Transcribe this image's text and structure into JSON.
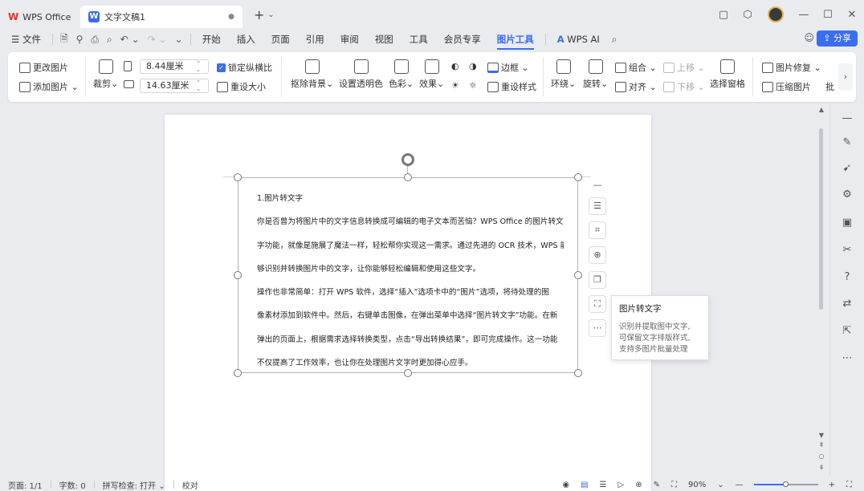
{
  "titlebar": {
    "home_tab": "WPS Office",
    "doc_tab": "文字文稿1",
    "doc_dot": "●",
    "new_tab_icon": "plus-icon"
  },
  "menubar": {
    "file": "文件",
    "items": [
      "开始",
      "插入",
      "页面",
      "引用",
      "审阅",
      "视图",
      "工具",
      "会员专享",
      "图片工具"
    ],
    "active": "图片工具",
    "wps_ai": "WPS AI",
    "share": "分享"
  },
  "ribbon": {
    "change_image": "更改图片",
    "add_image": "添加图片",
    "crop": "裁剪",
    "width_value": "8.44厘米",
    "height_value": "14.63厘米",
    "lock_ratio": "锁定纵横比",
    "reset_size": "重设大小",
    "remove_bg": "抠除背景",
    "set_transparent": "设置透明色",
    "color": "色彩",
    "effects": "效果",
    "border": "边框",
    "reset_style": "重设样式",
    "wrap": "环绕",
    "rotate": "旋转",
    "group": "组合",
    "align": "对齐",
    "move_up": "上移",
    "move_down": "下移",
    "selection_pane": "选择窗格",
    "image_repair": "图片修复",
    "compress": "压缩图片",
    "batch": "批"
  },
  "document": {
    "lines": [
      "1.图片转文字",
      "你是否曾为将图片中的文字信息转换成可编辑的电子文本而苦恼？WPS Office 的图片转文",
      "字功能，就像是施展了魔法一样，轻松帮你实现这一需求。通过先进的 OCR 技术，WPS 能",
      "够识别并转换图片中的文字，让你能够轻松编辑和使用这些文字。",
      "操作也非常简单：打开 WPS 软件，选择“插入”选项卡中的“图片”选项，将待处理的图",
      "像素材添加到软件中。然后，右键单击图像，在弹出菜单中选择“图片转文字”功能。在新",
      "弹出的页面上，根据需求选择转换类型，点击“导出转换结果”，即可完成操作。这一功能",
      "不仅提高了工作效率，也让你在处理图片文字时更加得心应手。"
    ]
  },
  "tooltip": {
    "title": "图片转文字",
    "body": [
      "识别并提取图中文字,",
      "可保留文字排版样式,",
      "支持多图片批量处理"
    ]
  },
  "statusbar": {
    "page": "页面: 1/1",
    "words": "字数: 0",
    "spell": "拼写检查: 打开",
    "proof": "校对",
    "zoom": "90%"
  },
  "colors": {
    "accent": "#3a6df0",
    "wps_red": "#e0352b"
  }
}
